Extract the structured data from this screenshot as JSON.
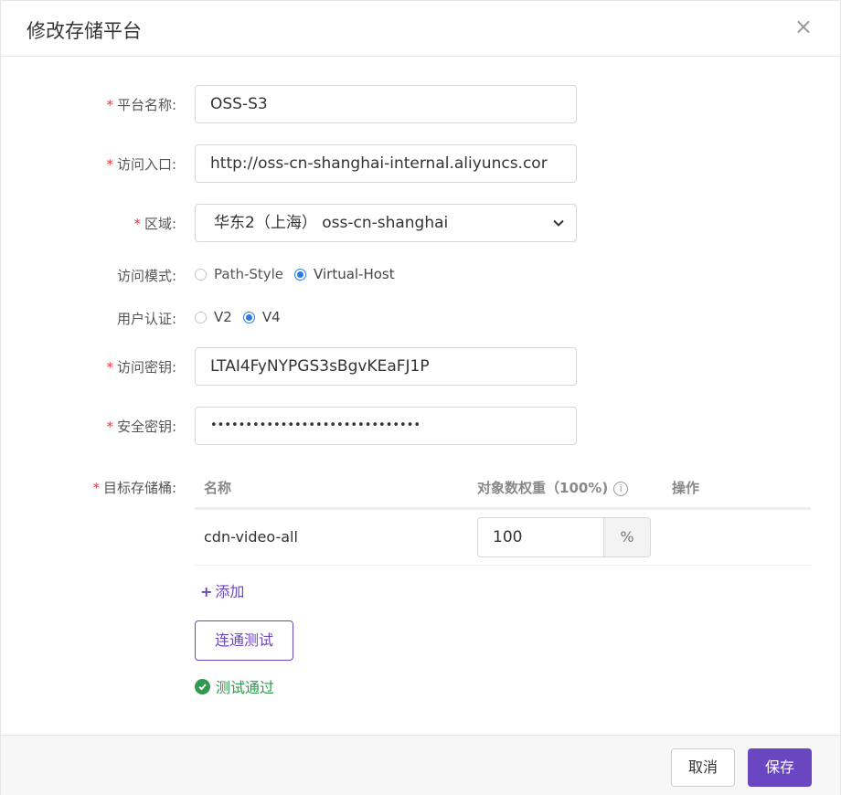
{
  "dialog": {
    "title": "修改存储平台",
    "close_glyph": "×"
  },
  "form": {
    "platform_name": {
      "label": "平台名称:",
      "required": "*",
      "value": "OSS-S3"
    },
    "endpoint": {
      "label": "访问入口:",
      "required": "*",
      "value": "http://oss-cn-shanghai-internal.aliyuncs.cor"
    },
    "region": {
      "label": "区域:",
      "required": "*",
      "value": "华东2（上海） oss-cn-shanghai"
    },
    "access_mode": {
      "label": "访问模式:",
      "options": [
        {
          "label": "Path-Style",
          "selected": false
        },
        {
          "label": "Virtual-Host",
          "selected": true
        }
      ]
    },
    "auth": {
      "label": "用户认证:",
      "options": [
        {
          "label": "V2",
          "selected": false
        },
        {
          "label": "V4",
          "selected": true
        }
      ]
    },
    "access_key": {
      "label": "访问密钥:",
      "required": "*",
      "value": "LTAI4FyNYPGS3sBgvKEaFJ1P"
    },
    "secret_key": {
      "label": "安全密钥:",
      "required": "*",
      "value": "••••••••••••••••••••••••••••••"
    },
    "buckets": {
      "label": "目标存储桶:",
      "required": "*",
      "columns": {
        "name": "名称",
        "weight": "对象数权重（100%)",
        "info_glyph": "i",
        "actions": "操作"
      },
      "rows": [
        {
          "name": "cdn-video-all",
          "weight": "100",
          "unit": "%"
        }
      ],
      "add_label": "添加",
      "add_glyph": "+"
    },
    "test_button": "连通测试",
    "test_status": "测试通过"
  },
  "footer": {
    "cancel": "取消",
    "save": "保存"
  },
  "colors": {
    "accent": "#6b46c1",
    "radio_selected": "#2c7be5",
    "success": "#2e9a4e",
    "required": "#e4393c"
  },
  "icons": [
    "close-icon",
    "chevron-down-icon",
    "info-icon",
    "plus-icon",
    "check-circle-icon"
  ]
}
